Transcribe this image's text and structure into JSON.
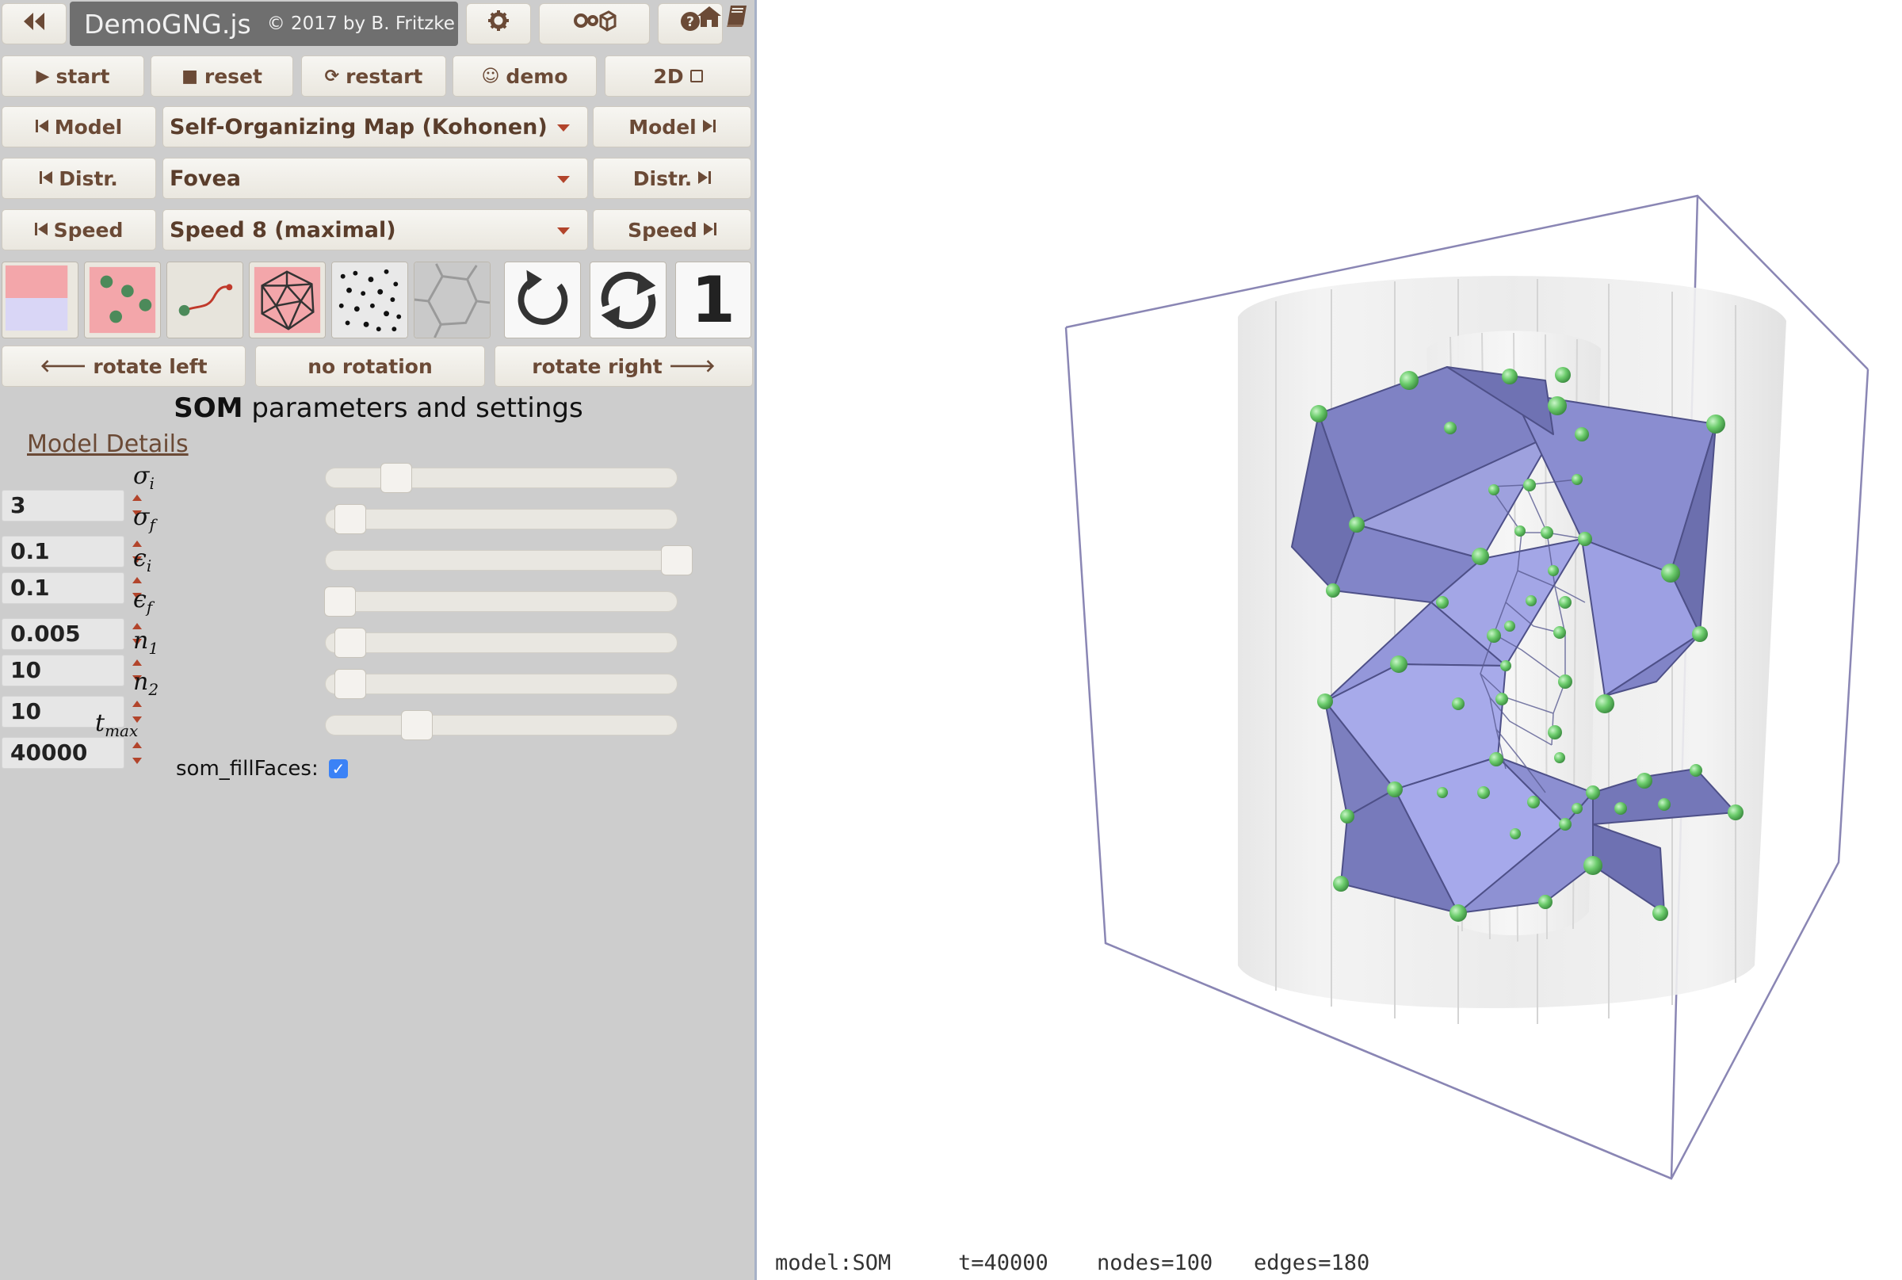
{
  "header": {
    "back_icon": "double-chevron-left-icon",
    "title": "DemoGNG.js",
    "copyright": "© 2017 by B. Fritzke",
    "settings_icon": "gear-icon",
    "advanced_icon": "gears-cube-icon",
    "help_icon": "help-icon",
    "home_icon": "home-icon",
    "book_icon": "book-icon"
  },
  "controls": {
    "start": "start",
    "reset": "reset",
    "restart": "restart",
    "demo": "demo",
    "mode": "2D",
    "model_prev": "Model",
    "model_next": "Model",
    "model_selected": "Self-Organizing Map (Kohonen)",
    "distr_prev": "Distr.",
    "distr_next": "Distr.",
    "distr_selected": "Fovea",
    "speed_prev": "Speed",
    "speed_next": "Speed",
    "speed_selected": "Speed 8 (maximal)",
    "rotate_left": "rotate left",
    "no_rotation": "no rotation",
    "rotate_right": "rotate right",
    "step_label": "1"
  },
  "toolbar_tiles": [
    {
      "name": "show-probability-tile",
      "icon": "probability-color-icon"
    },
    {
      "name": "show-signals-tile",
      "icon": "signals-dots-icon"
    },
    {
      "name": "show-edges-tile",
      "icon": "edge-curve-icon"
    },
    {
      "name": "show-network-tile",
      "icon": "icosahedron-icon"
    },
    {
      "name": "show-points-tile",
      "icon": "scatter-points-icon"
    },
    {
      "name": "show-voronoi-tile",
      "icon": "voronoi-icon"
    },
    {
      "name": "restart-cycle-tile",
      "icon": "refresh-icon"
    },
    {
      "name": "loop-tile",
      "icon": "repeat-icon"
    }
  ],
  "params": {
    "section_title_bold": "SOM",
    "section_title_rest": " parameters and settings",
    "model_details": "Model Details",
    "items": [
      {
        "symbol": "σ",
        "sub": "i",
        "value": "3",
        "slider": 0.2
      },
      {
        "symbol": "σ",
        "sub": "f",
        "value": "0.1",
        "slider": 0.07
      },
      {
        "symbol": "ϵ",
        "sub": "i",
        "value": "0.1",
        "slider": 1.0
      },
      {
        "symbol": "ϵ",
        "sub": "f",
        "value": "0.005",
        "slider": 0.04
      },
      {
        "symbol": "n",
        "sub": "1",
        "value": "10",
        "slider": 0.07
      },
      {
        "symbol": "n",
        "sub": "2",
        "value": "10",
        "slider": 0.07
      },
      {
        "symbol": "t",
        "sub": "max",
        "value": "40000",
        "slider": 0.26
      }
    ],
    "fill_faces_label": "som_fillFaces:",
    "fill_faces_checked": true
  },
  "status": {
    "model": "model:SOM",
    "t": "t=40000",
    "nodes": "nodes=100",
    "edges": "edges=180"
  },
  "colors": {
    "panel_bg": "#cdcdcd",
    "button_text": "#6b4a36",
    "caret": "#b2442b",
    "mesh_fill": "#8e91d1",
    "node": "#5cbf62",
    "box_edge": "#8a86b4"
  }
}
